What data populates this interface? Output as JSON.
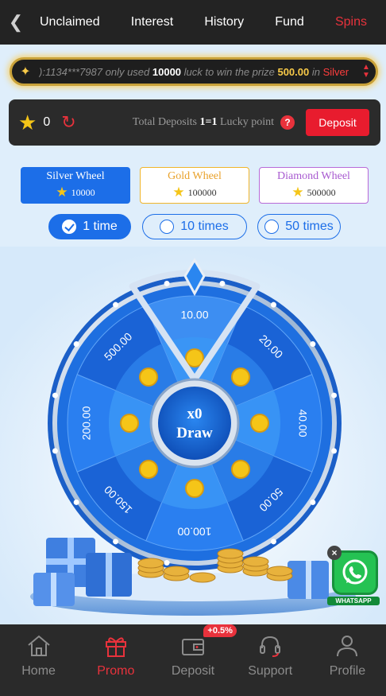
{
  "nav": {
    "back_icon": "chevron-left-icon",
    "tabs": [
      {
        "label": "Unclaimed",
        "active": false
      },
      {
        "label": "Interest",
        "active": false
      },
      {
        "label": "History",
        "active": false
      },
      {
        "label": "Fund",
        "active": false
      },
      {
        "label": "Spins",
        "active": true
      }
    ]
  },
  "marquee": {
    "prefix": "):1134***7987 only used",
    "luck_used": "10000",
    "middle": "luck to win the prize",
    "prize": "500.00",
    "in_word": "in",
    "wheel": "Silver"
  },
  "balance": {
    "value": "0",
    "total_deposits_label": "Total Deposits",
    "ratio": "1=1",
    "lucky_point_label": "Lucky point",
    "help": "?",
    "deposit_button": "Deposit"
  },
  "wheel_tabs": [
    {
      "name": "Silver Wheel",
      "cost": "10000",
      "active": true
    },
    {
      "name": "Gold Wheel",
      "cost": "100000",
      "active": false
    },
    {
      "name": "Diamond Wheel",
      "cost": "500000",
      "active": false
    }
  ],
  "times": [
    {
      "label": "1 time",
      "active": true
    },
    {
      "label": "10 times",
      "active": false
    },
    {
      "label": "50 times",
      "active": false
    }
  ],
  "wheel": {
    "prizes": [
      "10.00",
      "20.00",
      "40.00",
      "50.00",
      "100.00",
      "150.00",
      "200.00",
      "500.00"
    ],
    "draw_count": "x0",
    "draw_label": "Draw",
    "highlight_index": 0
  },
  "whatsapp": {
    "label": "WHATSAPP",
    "close": "×"
  },
  "bottom_nav": [
    {
      "label": "Home",
      "icon": "home-icon",
      "active": false
    },
    {
      "label": "Promo",
      "icon": "gift-icon",
      "active": true
    },
    {
      "label": "Deposit",
      "icon": "wallet-icon",
      "active": false,
      "badge": "+0.5%"
    },
    {
      "label": "Support",
      "icon": "headset-icon",
      "active": false
    },
    {
      "label": "Profile",
      "icon": "user-icon",
      "active": false
    }
  ],
  "colors": {
    "accent_red": "#e8323c",
    "accent_blue": "#1c6ee8",
    "gold": "#f5c518"
  }
}
